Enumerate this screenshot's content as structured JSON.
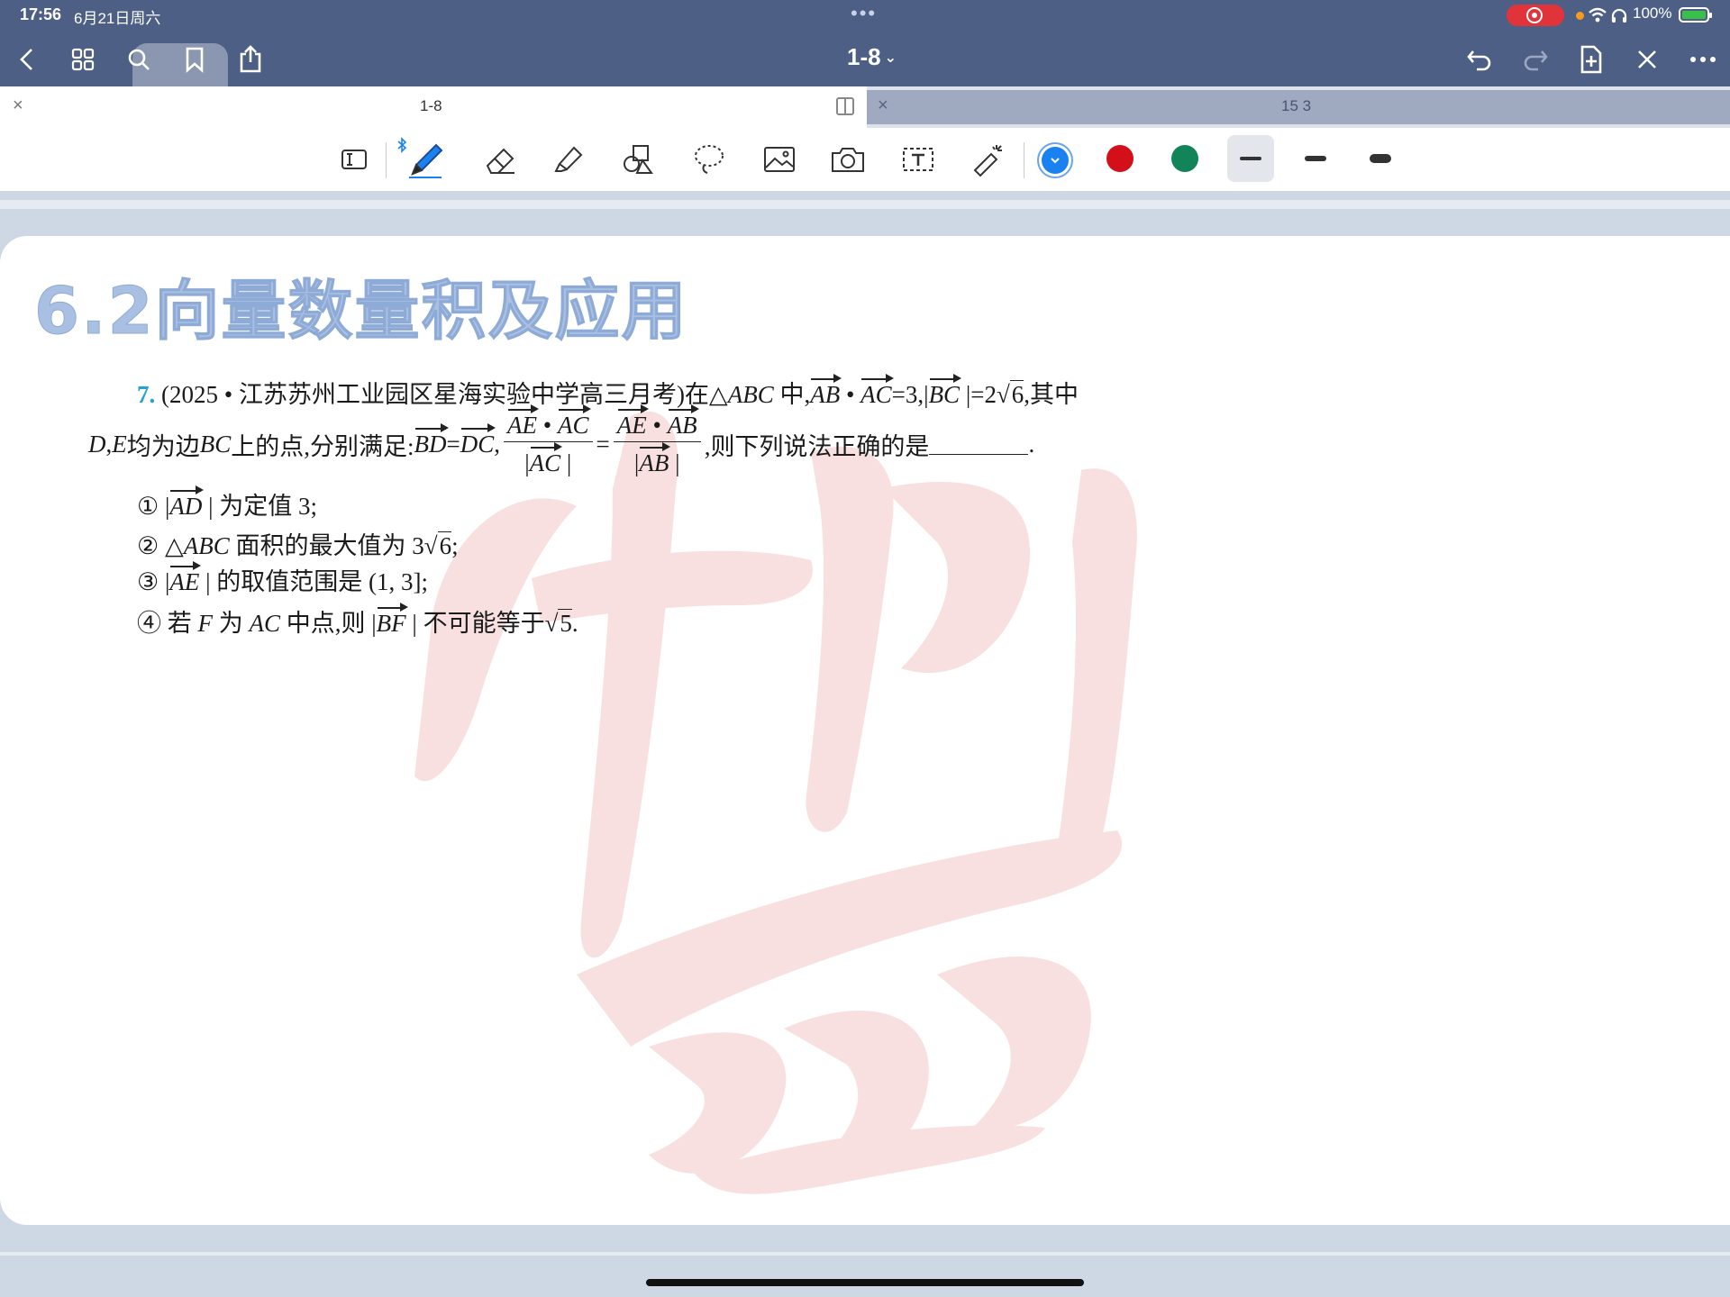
{
  "status": {
    "time": "17:56",
    "date": "6月21日周六",
    "battery": "100%"
  },
  "nav": {
    "title": "1-8"
  },
  "tabs": [
    {
      "label": "1-8",
      "active": true
    },
    {
      "label": "15 3",
      "active": false
    }
  ],
  "toolbar": {
    "tools": [
      "text-select-icon",
      "pen-icon",
      "eraser-icon",
      "highlighter-icon",
      "shapes-icon",
      "lasso-icon",
      "image-icon",
      "camera-icon",
      "textbox-icon",
      "laser-pointer-icon"
    ],
    "colors": [
      "#1a82f0",
      "#d3101a",
      "#12845a"
    ],
    "selected_color": "#1a82f0"
  },
  "page": {
    "heading": "6.2向量数量积及应用",
    "question": {
      "number": "7.",
      "source": "(2025 • 江苏苏州工业园区星海实验中学高三月考)在△",
      "l1_abc": "ABC",
      "l1_mid": " 中,",
      "v_ab": "AB",
      "dot": " • ",
      "v_ac": "AC",
      "eq3": "=3,",
      "bar": "|",
      "v_bc": "BC",
      "eq_2": " |=2",
      "sqrt6": "6",
      "qizhong": ",其中",
      "l2_de": "D",
      "l2_comma": ",",
      "l2_e": "E",
      "l2_text": " 均为边 ",
      "l2_bc": "BC",
      "l2_text2": " 上的点,分别满足:",
      "v_bd": "BD",
      "eq": " = ",
      "v_dc": "DC",
      "comma": ",",
      "v_ae": "AE",
      "v_ab2": "AB",
      "frac_eq": " = ",
      "tail": ",则下列说法正确的是",
      "period": "."
    },
    "options": {
      "o1_mark": "①",
      "o1_v": "AD",
      "o1_text": " | 为定值 3;",
      "o2_mark": "②",
      "o2_tri": " △",
      "o2_abc": "ABC",
      "o2_text": " 面积的最大值为 3",
      "o2_sqrt": "6",
      "o2_end": ";",
      "o3_mark": "③",
      "o3_v": "AE",
      "o3_text": " | 的取值范围是 (1, 3];",
      "o4_mark": "④",
      "o4_pre": " 若 ",
      "o4_f": "F",
      "o4_mid": " 为 ",
      "o4_ac": "AC",
      "o4_mid2": " 中点,则 |",
      "o4_v": "BF",
      "o4_text": " | 不可能等于",
      "o4_sqrt": "5",
      "o4_end": "."
    }
  }
}
